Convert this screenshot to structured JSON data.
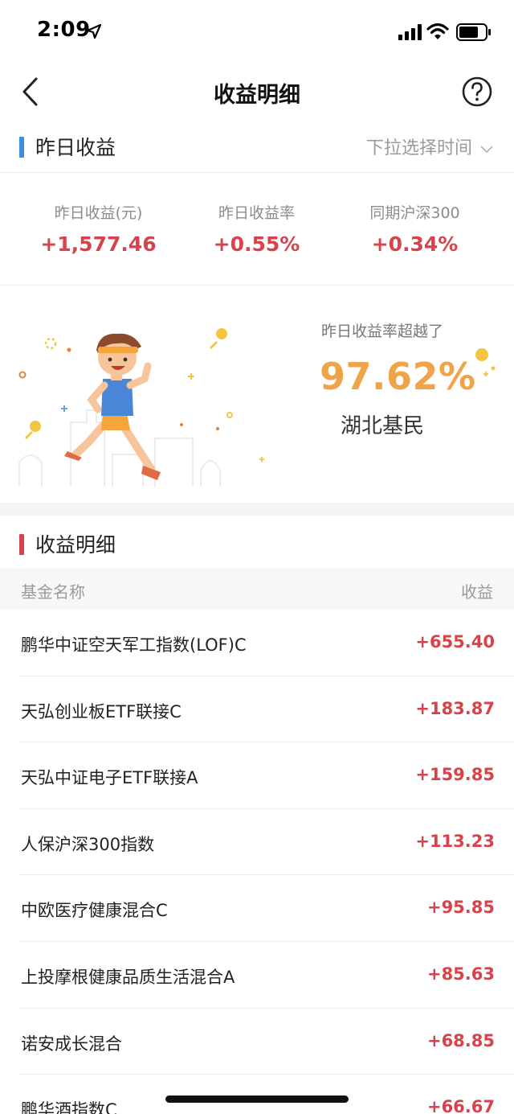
{
  "status_bar": {
    "time": "2:09"
  },
  "nav": {
    "title": "收益明细"
  },
  "yesterday_section": {
    "title": "昨日收益",
    "time_select": "下拉选择时间",
    "stats": [
      {
        "label": "昨日收益(元)",
        "value": "+1,577.46"
      },
      {
        "label": "昨日收益率",
        "value": "+0.55%"
      },
      {
        "label": "同期沪深300",
        "value": "+0.34%"
      }
    ]
  },
  "ranking": {
    "subtitle": "昨日收益率超越了",
    "percent": "97.62%",
    "region": "湖北基民"
  },
  "detail_section": {
    "title": "收益明细",
    "columns": {
      "name": "基金名称",
      "gain": "收益"
    },
    "rows": [
      {
        "name": "鹏华中证空天军工指数(LOF)C",
        "gain": "+655.40"
      },
      {
        "name": "天弘创业板ETF联接C",
        "gain": "+183.87"
      },
      {
        "name": "天弘中证电子ETF联接A",
        "gain": "+159.85"
      },
      {
        "name": "人保沪深300指数",
        "gain": "+113.23"
      },
      {
        "name": "中欧医疗健康混合C",
        "gain": "+95.85"
      },
      {
        "name": "上投摩根健康品质生活混合A",
        "gain": "+85.63"
      },
      {
        "name": "诺安成长混合",
        "gain": "+68.85"
      },
      {
        "name": "鹏华酒指数C",
        "gain": "+66.67"
      }
    ]
  },
  "colors": {
    "accent_blue": "#3d8fe0",
    "accent_red": "#d8424a",
    "gain_red": "#d8424a",
    "percent_orange": "#f0a44a"
  },
  "icons": [
    "location-arrow-icon",
    "signal-icon",
    "wifi-icon",
    "battery-icon",
    "back-icon",
    "help-icon",
    "chevron-down-icon"
  ]
}
